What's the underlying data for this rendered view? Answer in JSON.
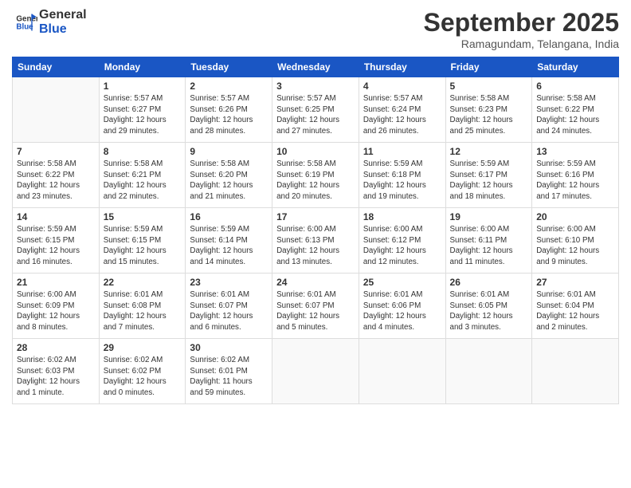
{
  "logo": {
    "line1": "General",
    "line2": "Blue"
  },
  "title": "September 2025",
  "subtitle": "Ramagundam, Telangana, India",
  "days_of_week": [
    "Sunday",
    "Monday",
    "Tuesday",
    "Wednesday",
    "Thursday",
    "Friday",
    "Saturday"
  ],
  "weeks": [
    [
      {
        "num": "",
        "info": ""
      },
      {
        "num": "1",
        "info": "Sunrise: 5:57 AM\nSunset: 6:27 PM\nDaylight: 12 hours\nand 29 minutes."
      },
      {
        "num": "2",
        "info": "Sunrise: 5:57 AM\nSunset: 6:26 PM\nDaylight: 12 hours\nand 28 minutes."
      },
      {
        "num": "3",
        "info": "Sunrise: 5:57 AM\nSunset: 6:25 PM\nDaylight: 12 hours\nand 27 minutes."
      },
      {
        "num": "4",
        "info": "Sunrise: 5:57 AM\nSunset: 6:24 PM\nDaylight: 12 hours\nand 26 minutes."
      },
      {
        "num": "5",
        "info": "Sunrise: 5:58 AM\nSunset: 6:23 PM\nDaylight: 12 hours\nand 25 minutes."
      },
      {
        "num": "6",
        "info": "Sunrise: 5:58 AM\nSunset: 6:22 PM\nDaylight: 12 hours\nand 24 minutes."
      }
    ],
    [
      {
        "num": "7",
        "info": "Sunrise: 5:58 AM\nSunset: 6:22 PM\nDaylight: 12 hours\nand 23 minutes."
      },
      {
        "num": "8",
        "info": "Sunrise: 5:58 AM\nSunset: 6:21 PM\nDaylight: 12 hours\nand 22 minutes."
      },
      {
        "num": "9",
        "info": "Sunrise: 5:58 AM\nSunset: 6:20 PM\nDaylight: 12 hours\nand 21 minutes."
      },
      {
        "num": "10",
        "info": "Sunrise: 5:58 AM\nSunset: 6:19 PM\nDaylight: 12 hours\nand 20 minutes."
      },
      {
        "num": "11",
        "info": "Sunrise: 5:59 AM\nSunset: 6:18 PM\nDaylight: 12 hours\nand 19 minutes."
      },
      {
        "num": "12",
        "info": "Sunrise: 5:59 AM\nSunset: 6:17 PM\nDaylight: 12 hours\nand 18 minutes."
      },
      {
        "num": "13",
        "info": "Sunrise: 5:59 AM\nSunset: 6:16 PM\nDaylight: 12 hours\nand 17 minutes."
      }
    ],
    [
      {
        "num": "14",
        "info": "Sunrise: 5:59 AM\nSunset: 6:15 PM\nDaylight: 12 hours\nand 16 minutes."
      },
      {
        "num": "15",
        "info": "Sunrise: 5:59 AM\nSunset: 6:15 PM\nDaylight: 12 hours\nand 15 minutes."
      },
      {
        "num": "16",
        "info": "Sunrise: 5:59 AM\nSunset: 6:14 PM\nDaylight: 12 hours\nand 14 minutes."
      },
      {
        "num": "17",
        "info": "Sunrise: 6:00 AM\nSunset: 6:13 PM\nDaylight: 12 hours\nand 13 minutes."
      },
      {
        "num": "18",
        "info": "Sunrise: 6:00 AM\nSunset: 6:12 PM\nDaylight: 12 hours\nand 12 minutes."
      },
      {
        "num": "19",
        "info": "Sunrise: 6:00 AM\nSunset: 6:11 PM\nDaylight: 12 hours\nand 11 minutes."
      },
      {
        "num": "20",
        "info": "Sunrise: 6:00 AM\nSunset: 6:10 PM\nDaylight: 12 hours\nand 9 minutes."
      }
    ],
    [
      {
        "num": "21",
        "info": "Sunrise: 6:00 AM\nSunset: 6:09 PM\nDaylight: 12 hours\nand 8 minutes."
      },
      {
        "num": "22",
        "info": "Sunrise: 6:01 AM\nSunset: 6:08 PM\nDaylight: 12 hours\nand 7 minutes."
      },
      {
        "num": "23",
        "info": "Sunrise: 6:01 AM\nSunset: 6:07 PM\nDaylight: 12 hours\nand 6 minutes."
      },
      {
        "num": "24",
        "info": "Sunrise: 6:01 AM\nSunset: 6:07 PM\nDaylight: 12 hours\nand 5 minutes."
      },
      {
        "num": "25",
        "info": "Sunrise: 6:01 AM\nSunset: 6:06 PM\nDaylight: 12 hours\nand 4 minutes."
      },
      {
        "num": "26",
        "info": "Sunrise: 6:01 AM\nSunset: 6:05 PM\nDaylight: 12 hours\nand 3 minutes."
      },
      {
        "num": "27",
        "info": "Sunrise: 6:01 AM\nSunset: 6:04 PM\nDaylight: 12 hours\nand 2 minutes."
      }
    ],
    [
      {
        "num": "28",
        "info": "Sunrise: 6:02 AM\nSunset: 6:03 PM\nDaylight: 12 hours\nand 1 minute."
      },
      {
        "num": "29",
        "info": "Sunrise: 6:02 AM\nSunset: 6:02 PM\nDaylight: 12 hours\nand 0 minutes."
      },
      {
        "num": "30",
        "info": "Sunrise: 6:02 AM\nSunset: 6:01 PM\nDaylight: 11 hours\nand 59 minutes."
      },
      {
        "num": "",
        "info": ""
      },
      {
        "num": "",
        "info": ""
      },
      {
        "num": "",
        "info": ""
      },
      {
        "num": "",
        "info": ""
      }
    ]
  ]
}
